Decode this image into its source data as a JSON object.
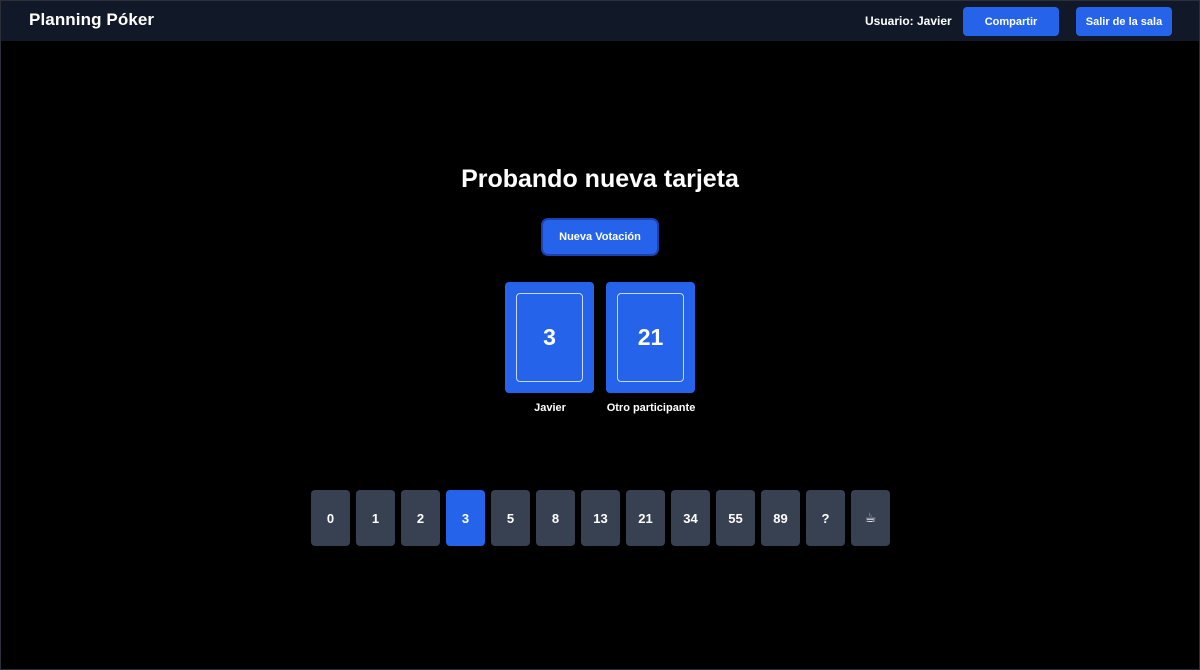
{
  "header": {
    "brand": "Planning Póker",
    "user_label": "Usuario: Javier",
    "share_label": "Compartir",
    "leave_label": "Salir de la sala"
  },
  "room": {
    "title": "Probando nueva tarjeta",
    "new_vote_label": "Nueva Votación"
  },
  "votes": [
    {
      "participant": "Javier",
      "value": "3"
    },
    {
      "participant": "Otro participante",
      "value": "21"
    }
  ],
  "deck": {
    "cards": [
      "0",
      "1",
      "2",
      "3",
      "5",
      "8",
      "13",
      "21",
      "34",
      "55",
      "89",
      "?",
      "☕"
    ],
    "selected": "3"
  },
  "colors": {
    "accent": "#2563eb",
    "topbar": "#111827",
    "card_idle": "#374151",
    "background": "#000000"
  }
}
